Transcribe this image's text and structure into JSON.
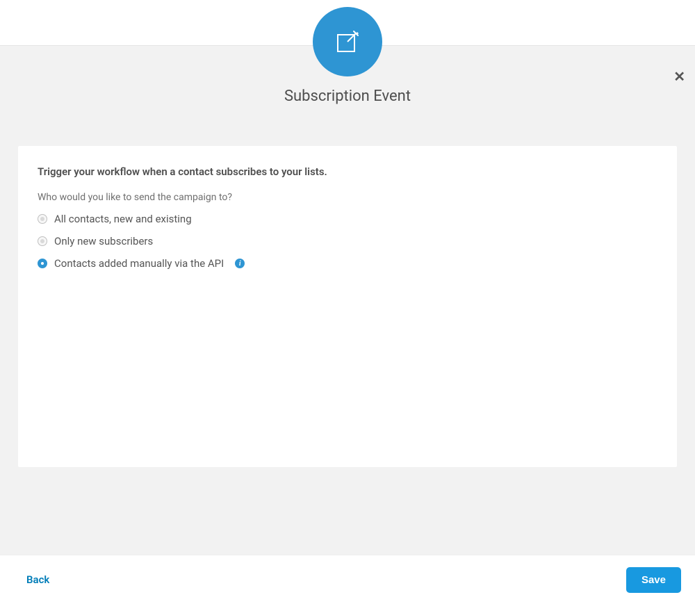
{
  "header": {
    "title": "Subscription Event",
    "close_symbol": "✕"
  },
  "panel": {
    "heading": "Trigger your workflow when a contact subscribes to your lists.",
    "subheading": "Who would you like to send the campaign to?",
    "options": [
      {
        "label": "All contacts, new and existing",
        "selected": false
      },
      {
        "label": "Only new subscribers",
        "selected": false
      },
      {
        "label": "Contacts added manually via the API",
        "selected": true,
        "has_info": true
      }
    ]
  },
  "footer": {
    "back_label": "Back",
    "save_label": "Save"
  },
  "colors": {
    "accent": "#2e95d3",
    "save_button": "#1899e0",
    "back_link": "#007db8"
  }
}
